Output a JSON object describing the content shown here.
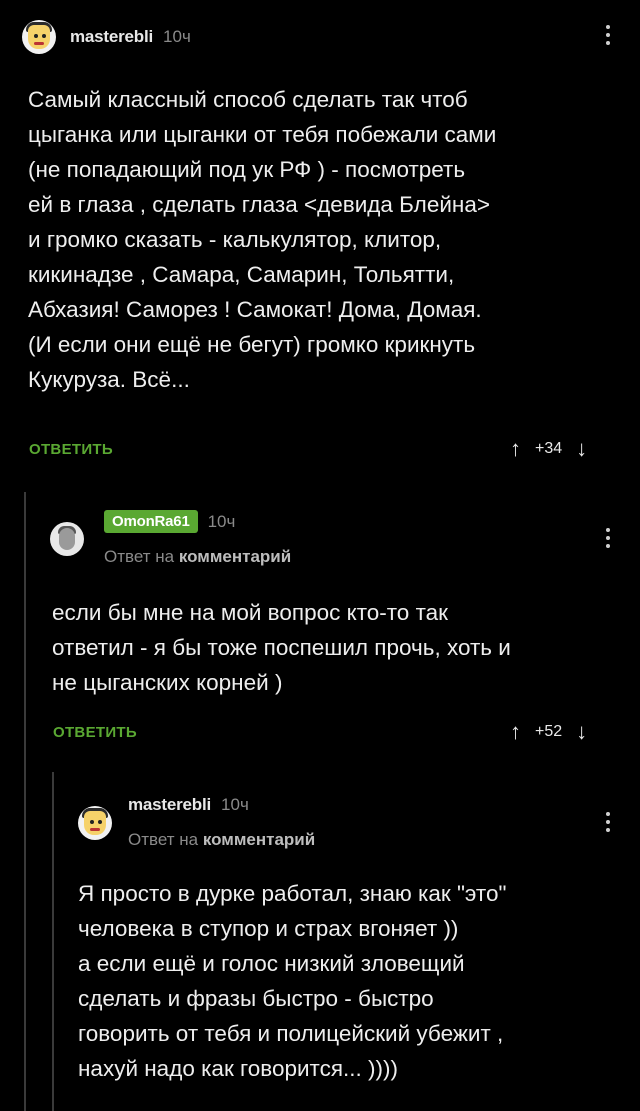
{
  "comments": [
    {
      "user": "masterebli",
      "time": "10ч",
      "text": "Самый классный способ сделать так чтоб\nцыганка или цыганки от тебя побежали сами\n(не попадающий под ук РФ ) - посмотреть\nей в глаза , сделать глаза <девида Блейна>\nи громко сказать - калькулятор, клитор,\nкикинадзе , Самара, Самарин, Тольятти,\nАбхазия! Саморез ! Самокат! Дома, Домая.\n(И если они ещё не бегут) громко крикнуть\nКукуруза. Всё...",
      "reply_label": "ОТВЕТИТЬ",
      "score": "+34"
    },
    {
      "user": "OmonRa61",
      "time": "10ч",
      "reply_to_prefix": "Ответ на",
      "reply_to_target": "комментарий",
      "text": "если бы мне на мой вопрос кто-то так\nответил - я бы тоже поспешил прочь, хоть и\nне цыганских корней )",
      "reply_label": "ОТВЕТИТЬ",
      "score": "+52"
    },
    {
      "user": "masterebli",
      "time": "10ч",
      "reply_to_prefix": "Ответ на",
      "reply_to_target": "комментарий",
      "text": "Я просто в дурке работал, знаю как \"это\"\nчеловека в ступор и страх вгоняет ))\nа если ещё и голос низкий зловещий\nсделать и фразы быстро - быстро\nговорить от тебя и полицейский убежит ,\nнахуй надо как говорится... ))))"
    }
  ],
  "icons": {
    "upvote": "↑",
    "downvote": "↓"
  }
}
